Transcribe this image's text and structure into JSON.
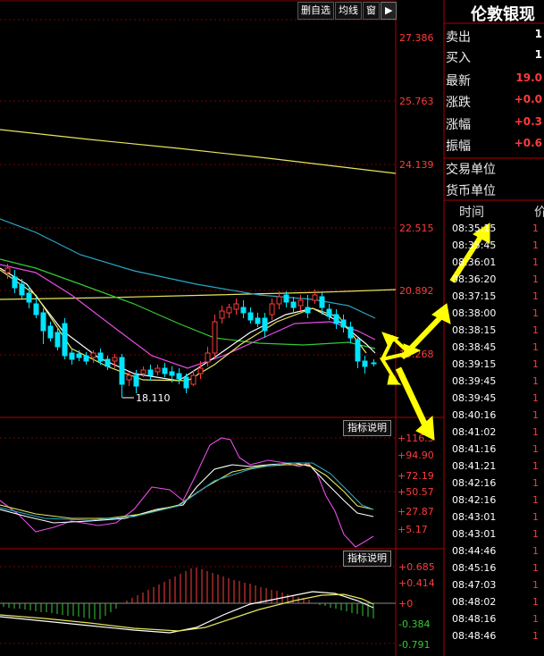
{
  "toolbar": {
    "remove_watchlist": "删自选",
    "moving_avg": "均线",
    "window": "窗",
    "arrow": "▶"
  },
  "price_axis": [
    "27.386",
    "25.763",
    "24.139",
    "22.515",
    "20.892",
    "19.268"
  ],
  "low_marker": "18.110",
  "indicator_button": "指标说明",
  "kdj_axis": [
    "+116.5",
    "+94.90",
    "+72.19",
    "+50.57",
    "+27.87",
    "+5.17"
  ],
  "macd_axis": [
    "+0.685",
    "+0.414",
    "+0",
    "-0.384",
    "-0.791"
  ],
  "colors": {
    "up": "#ff3b3b",
    "down": "#00e5ff",
    "grid": "#7a0000",
    "ma_yellow": "#e6e65c",
    "ma_white": "#ffffff",
    "ma_magenta": "#e64ce6",
    "ma_green": "#33cc33",
    "ma_cyan": "#2aa6c8",
    "arrow": "#ffff00"
  },
  "quote_panel": {
    "title": "伦敦银现",
    "rows": [
      {
        "label": "卖出",
        "value": "1"
      },
      {
        "label": "买入",
        "value": "1"
      },
      {
        "label": "最新",
        "value": "19.0"
      },
      {
        "label": "涨跌",
        "value": "+0.0"
      },
      {
        "label": "涨幅",
        "value": "+0.3"
      },
      {
        "label": "振幅",
        "value": "+0.6"
      },
      {
        "label": "交易单位",
        "value": ""
      },
      {
        "label": "货币单位",
        "value": ""
      }
    ]
  },
  "tick_list": {
    "time_header": "时间",
    "price_header": "价",
    "rows": [
      {
        "time": "08:35:15",
        "price": "1"
      },
      {
        "time": "08:35:45",
        "price": "1"
      },
      {
        "time": "08:36:01",
        "price": "1"
      },
      {
        "time": "08:36:20",
        "price": "1"
      },
      {
        "time": "08:37:15",
        "price": "1"
      },
      {
        "time": "08:38:00",
        "price": "1"
      },
      {
        "time": "08:38:15",
        "price": "1"
      },
      {
        "time": "08:38:45",
        "price": "1"
      },
      {
        "time": "08:39:15",
        "price": "1"
      },
      {
        "time": "08:39:45",
        "price": "1"
      },
      {
        "time": "08:39:45",
        "price": "1"
      },
      {
        "time": "08:40:16",
        "price": "1"
      },
      {
        "time": "08:41:02",
        "price": "1"
      },
      {
        "time": "08:41:16",
        "price": "1"
      },
      {
        "time": "08:41:21",
        "price": "1"
      },
      {
        "time": "08:42:16",
        "price": "1"
      },
      {
        "time": "08:42:16",
        "price": "1"
      },
      {
        "time": "08:43:01",
        "price": "1"
      },
      {
        "time": "08:43:01",
        "price": "1"
      },
      {
        "time": "08:44:46",
        "price": "1"
      },
      {
        "time": "08:45:16",
        "price": "1"
      },
      {
        "time": "08:47:03",
        "price": "1"
      },
      {
        "time": "08:48:02",
        "price": "1"
      },
      {
        "time": "08:48:16",
        "price": "1"
      },
      {
        "time": "08:48:46",
        "price": "1"
      }
    ]
  }
}
